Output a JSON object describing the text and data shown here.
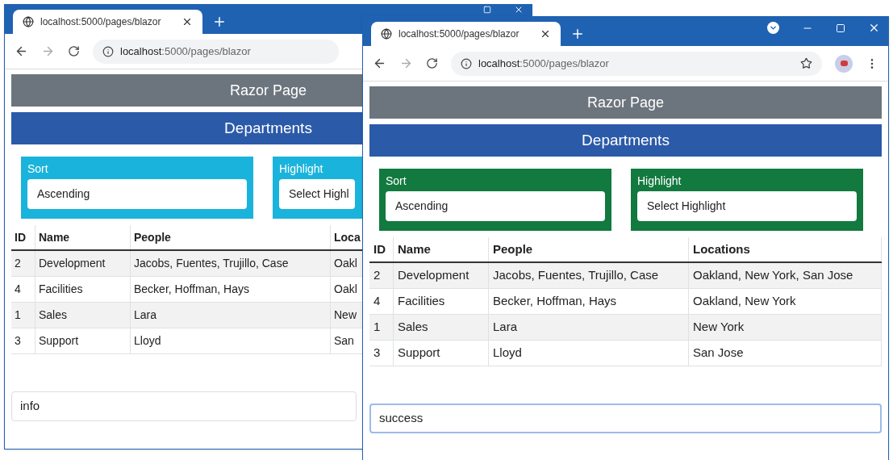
{
  "windows": [
    {
      "kind": "info",
      "tab_title": "localhost:5000/pages/blazor",
      "address_host": "localhost",
      "address_path": ":5000/pages/blazor",
      "header": "Razor Page",
      "title": "Departments",
      "filters": [
        {
          "label": "Sort",
          "value": "Ascending"
        },
        {
          "label": "Highlight",
          "value": "Select Highl"
        }
      ],
      "columns": [
        "ID",
        "Name",
        "People",
        "Loca"
      ],
      "rows": [
        [
          "2",
          "Development",
          "Jacobs, Fuentes, Trujillo, Case",
          "Oakl"
        ],
        [
          "4",
          "Facilities",
          "Becker, Hoffman, Hays",
          "Oakl"
        ],
        [
          "1",
          "Sales",
          "Lara",
          "New"
        ],
        [
          "3",
          "Support",
          "Lloyd",
          "San"
        ]
      ],
      "footer": {
        "value": "info",
        "focused": false
      }
    },
    {
      "kind": "success",
      "tab_title": "localhost:5000/pages/blazor",
      "address_host": "localhost",
      "address_path": ":5000/pages/blazor",
      "header": "Razor Page",
      "title": "Departments",
      "filters": [
        {
          "label": "Sort",
          "value": "Ascending"
        },
        {
          "label": "Highlight",
          "value": "Select Highlight"
        }
      ],
      "columns": [
        "ID",
        "Name",
        "People",
        "Locations"
      ],
      "rows": [
        [
          "2",
          "Development",
          "Jacobs, Fuentes, Trujillo, Case",
          "Oakland, New York, San Jose"
        ],
        [
          "4",
          "Facilities",
          "Becker, Hoffman, Hays",
          "Oakland, New York"
        ],
        [
          "1",
          "Sales",
          "Lara",
          "New York"
        ],
        [
          "3",
          "Support",
          "Lloyd",
          "San Jose"
        ]
      ],
      "footer": {
        "value": "success",
        "focused": true
      }
    }
  ]
}
